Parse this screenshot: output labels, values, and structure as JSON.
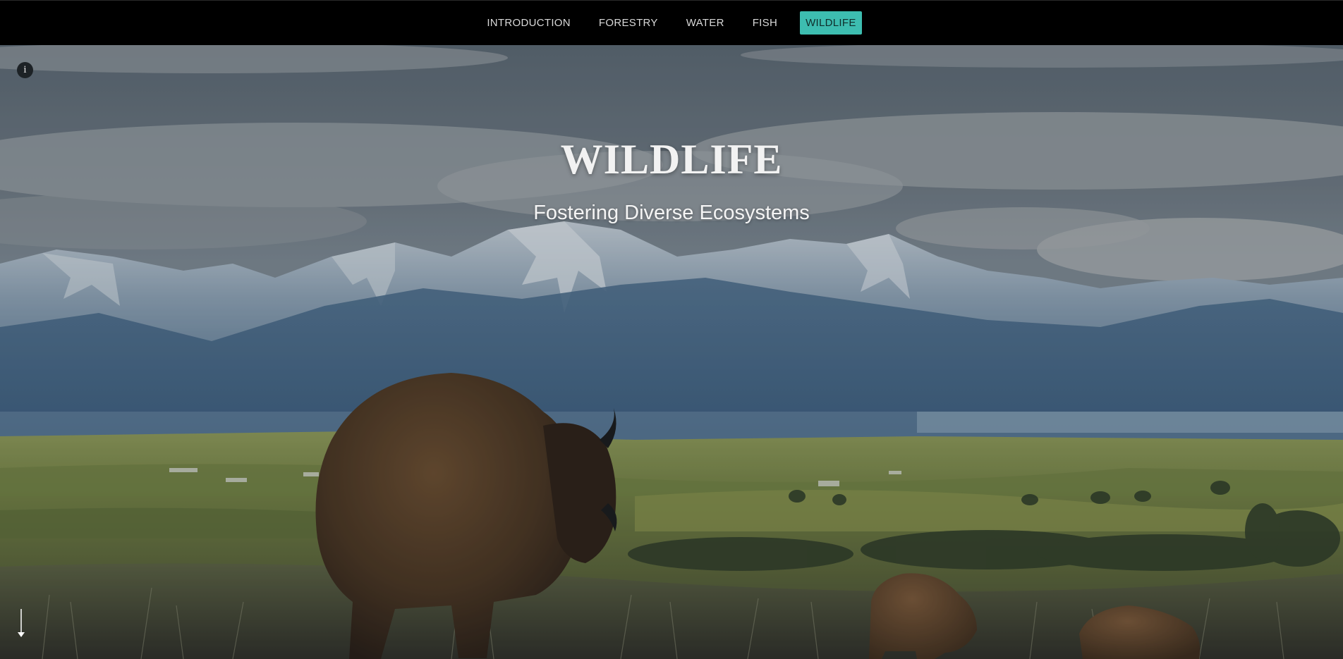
{
  "nav": {
    "items": [
      {
        "label": "INTRODUCTION",
        "active": false
      },
      {
        "label": "FORESTRY",
        "active": false
      },
      {
        "label": "WATER",
        "active": false
      },
      {
        "label": "FISH",
        "active": false
      },
      {
        "label": "WILDLIFE",
        "active": true
      }
    ],
    "accent_color": "#3dbdb0"
  },
  "hero": {
    "title": "WILDLIFE",
    "subtitle": "Fostering Diverse Ecosystems",
    "info_icon": "info-icon",
    "info_glyph": "i",
    "scroll_icon": "arrow-down-icon"
  }
}
